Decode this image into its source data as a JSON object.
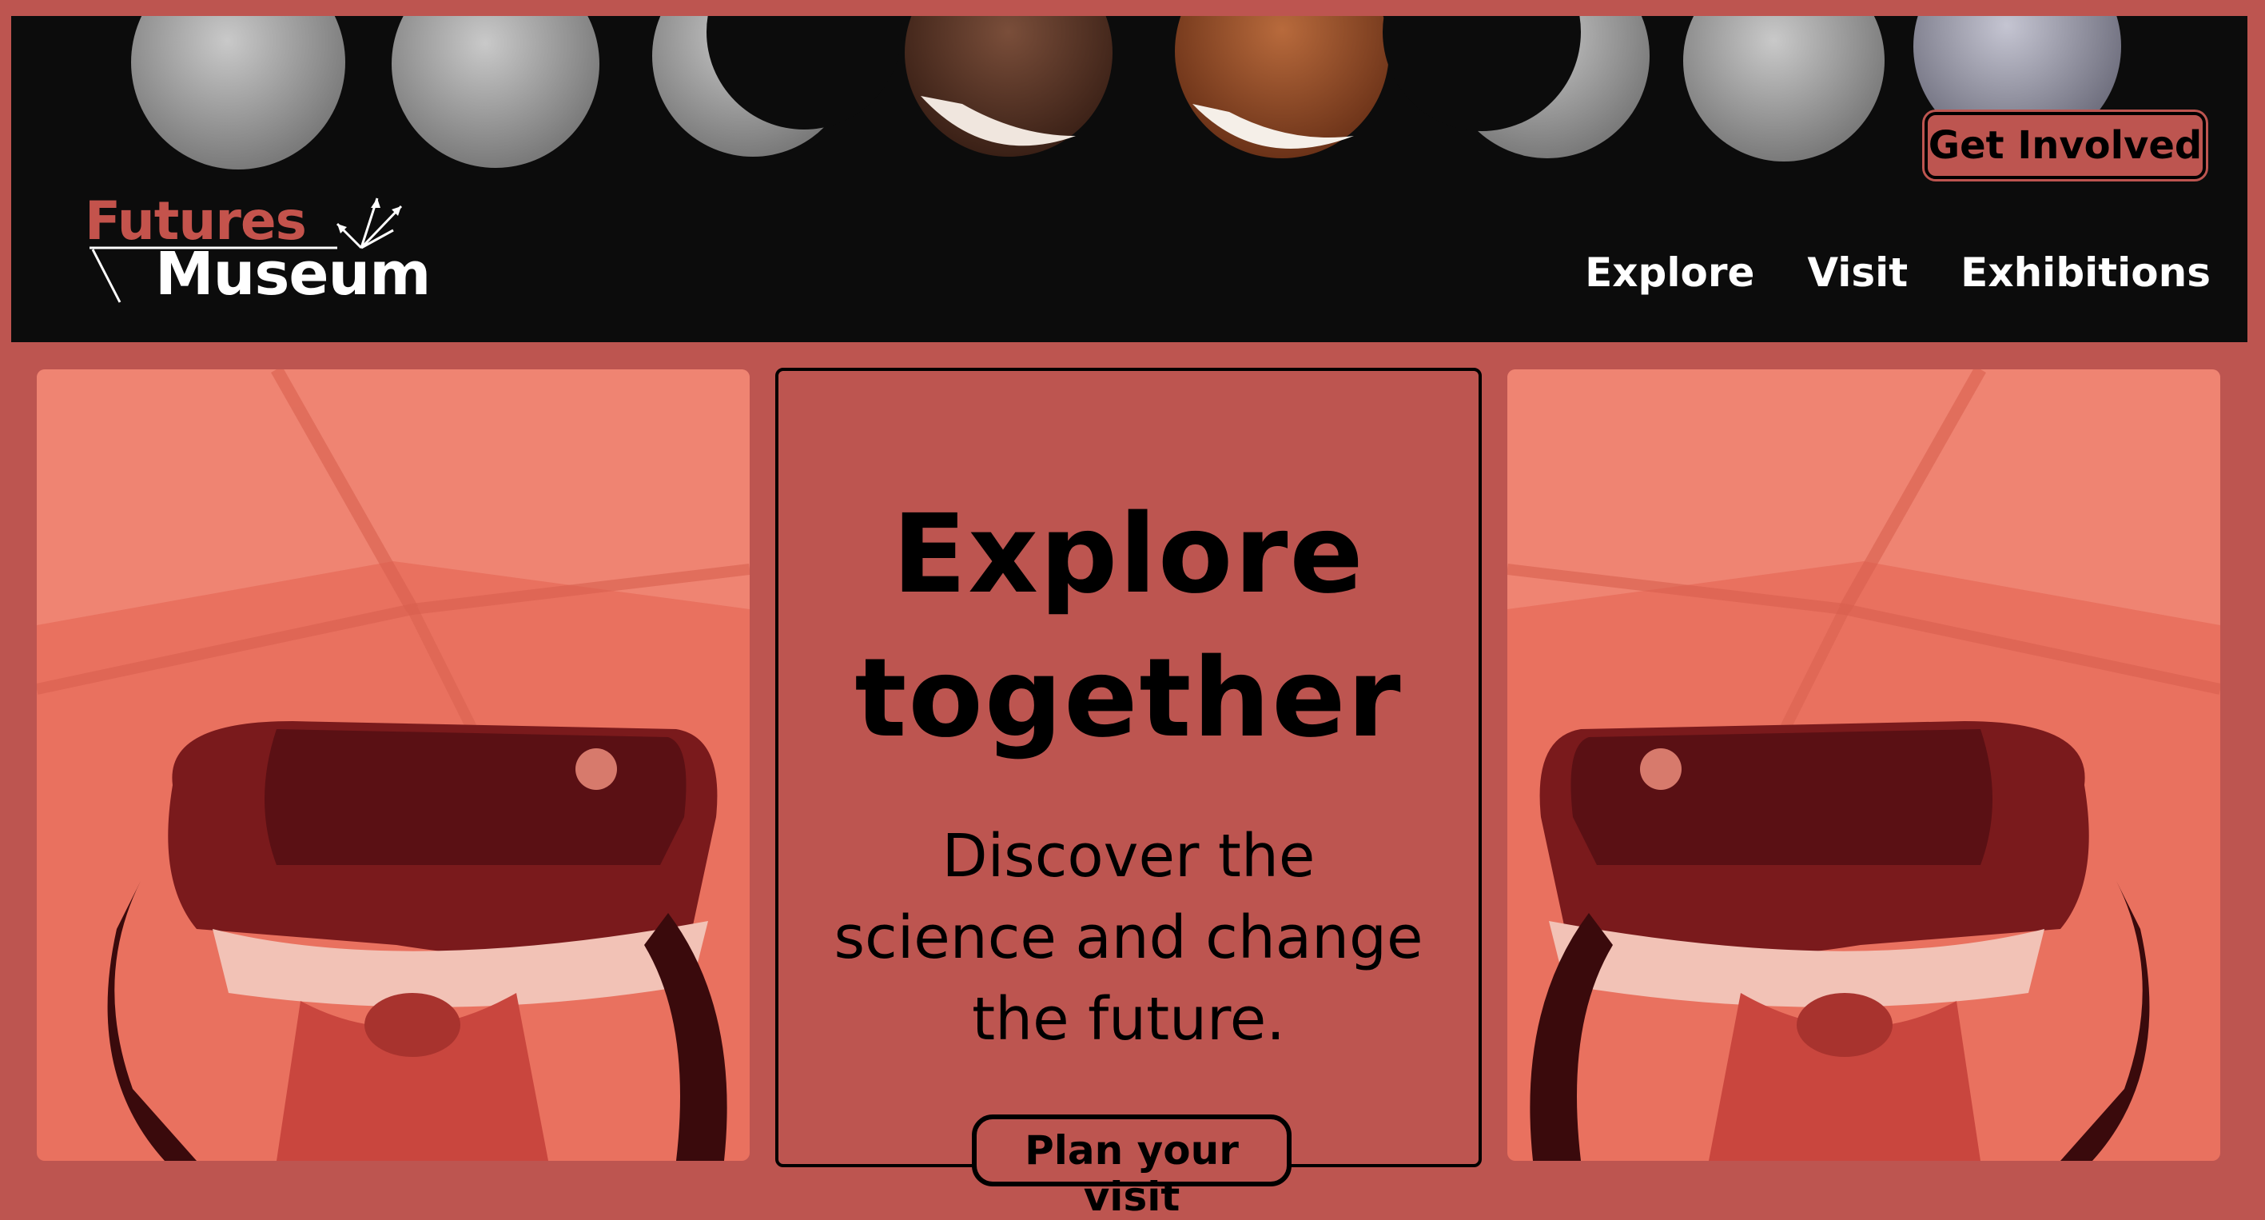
{
  "colors": {
    "page_background": "#bd5550",
    "header_background": "#0c0c0c",
    "brand_red": "#c4534c",
    "nav_text": "#ffffff",
    "image_tint": "#e9715f"
  },
  "header": {
    "logo": {
      "line1": "Futures",
      "line2": "Museum"
    },
    "cta_label": "Get Involved",
    "nav": [
      {
        "label": "Explore"
      },
      {
        "label": "Visit"
      },
      {
        "label": "Exhibitions"
      }
    ],
    "banner_image": "lunar-eclipse-phases"
  },
  "hero": {
    "left_image": "vr-headset-photo",
    "right_image": "vr-headset-photo",
    "title_line1": "Explore",
    "title_line2": "together",
    "subtitle_line1": "Discover the",
    "subtitle_line2": "science and change",
    "subtitle_line3": "the future.",
    "button_label": "Plan your visit"
  }
}
